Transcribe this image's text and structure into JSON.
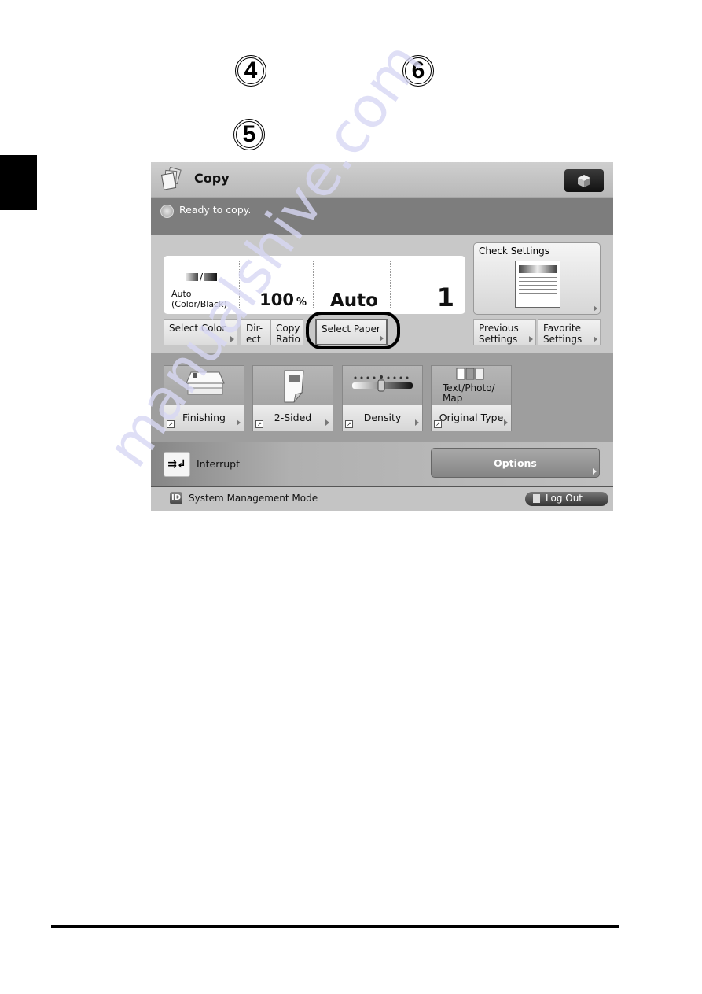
{
  "callouts": [
    "4",
    "6",
    "5"
  ],
  "titlebar": {
    "title": "Copy",
    "app_icon": "copy-stack-icon",
    "right_button_icon": "cube-icon"
  },
  "status": {
    "icon": "status-indicator-icon",
    "message": "Ready to copy."
  },
  "display": {
    "color_mode_label_line1": "Auto",
    "color_mode_label_line2": "(Color/Black)",
    "copy_ratio_value": "100",
    "copy_ratio_unit": "%",
    "paper_value": "Auto",
    "quantity_value": "1"
  },
  "buttons": {
    "select_color": "Select Color",
    "direct_line1": "Dir-",
    "direct_line2": "ect",
    "copy_ratio_line1": "Copy",
    "copy_ratio_line2": "Ratio",
    "select_paper": "Select Paper",
    "check_settings": "Check Settings",
    "previous_settings_line1": "Previous",
    "previous_settings_line2": "Settings",
    "favorite_settings_line1": "Favorite",
    "favorite_settings_line2": "Settings"
  },
  "functions": [
    {
      "name": "Finishing",
      "icon": "finishing-icon"
    },
    {
      "name": "2-Sided",
      "icon": "two-sided-icon"
    },
    {
      "name": "Density",
      "icon": "density-slider-icon"
    },
    {
      "name": "Original Type",
      "icon": "original-type-icon",
      "sub_line1": "Text/Photo/",
      "sub_line2": "Map"
    }
  ],
  "interrupt": {
    "label": "Interrupt"
  },
  "options": {
    "label": "Options"
  },
  "footer": {
    "id_badge": "ID",
    "mode_text": "System Management Mode",
    "logout_label": "Log Out"
  },
  "watermark": "manualshive.com"
}
